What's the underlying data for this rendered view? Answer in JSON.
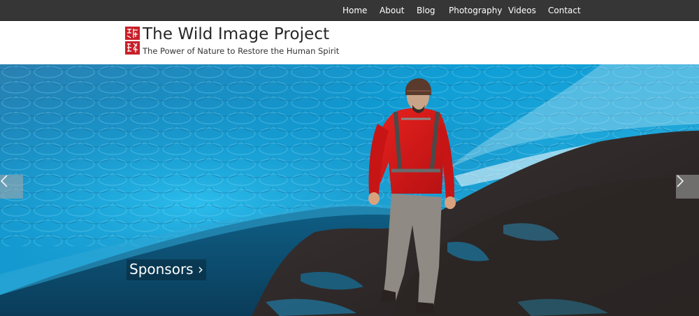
{
  "nav": {
    "items": [
      {
        "label": "Home"
      },
      {
        "label": "About"
      },
      {
        "label": "Blog"
      },
      {
        "label": "Photography"
      },
      {
        "label": "Videos"
      },
      {
        "label": "Contact"
      }
    ]
  },
  "header": {
    "title": "The Wild Image Project",
    "tagline": "The Power of Nature to Restore the Human Spirit",
    "logo_color": "#c8202a"
  },
  "slider": {
    "caption": "Sponsors ›",
    "prev_icon": "chevron-left-icon",
    "next_icon": "chevron-right-icon"
  },
  "colors": {
    "topbar": "#363636",
    "ice": "#1a8fc4",
    "jacket": "#d81a1a"
  }
}
